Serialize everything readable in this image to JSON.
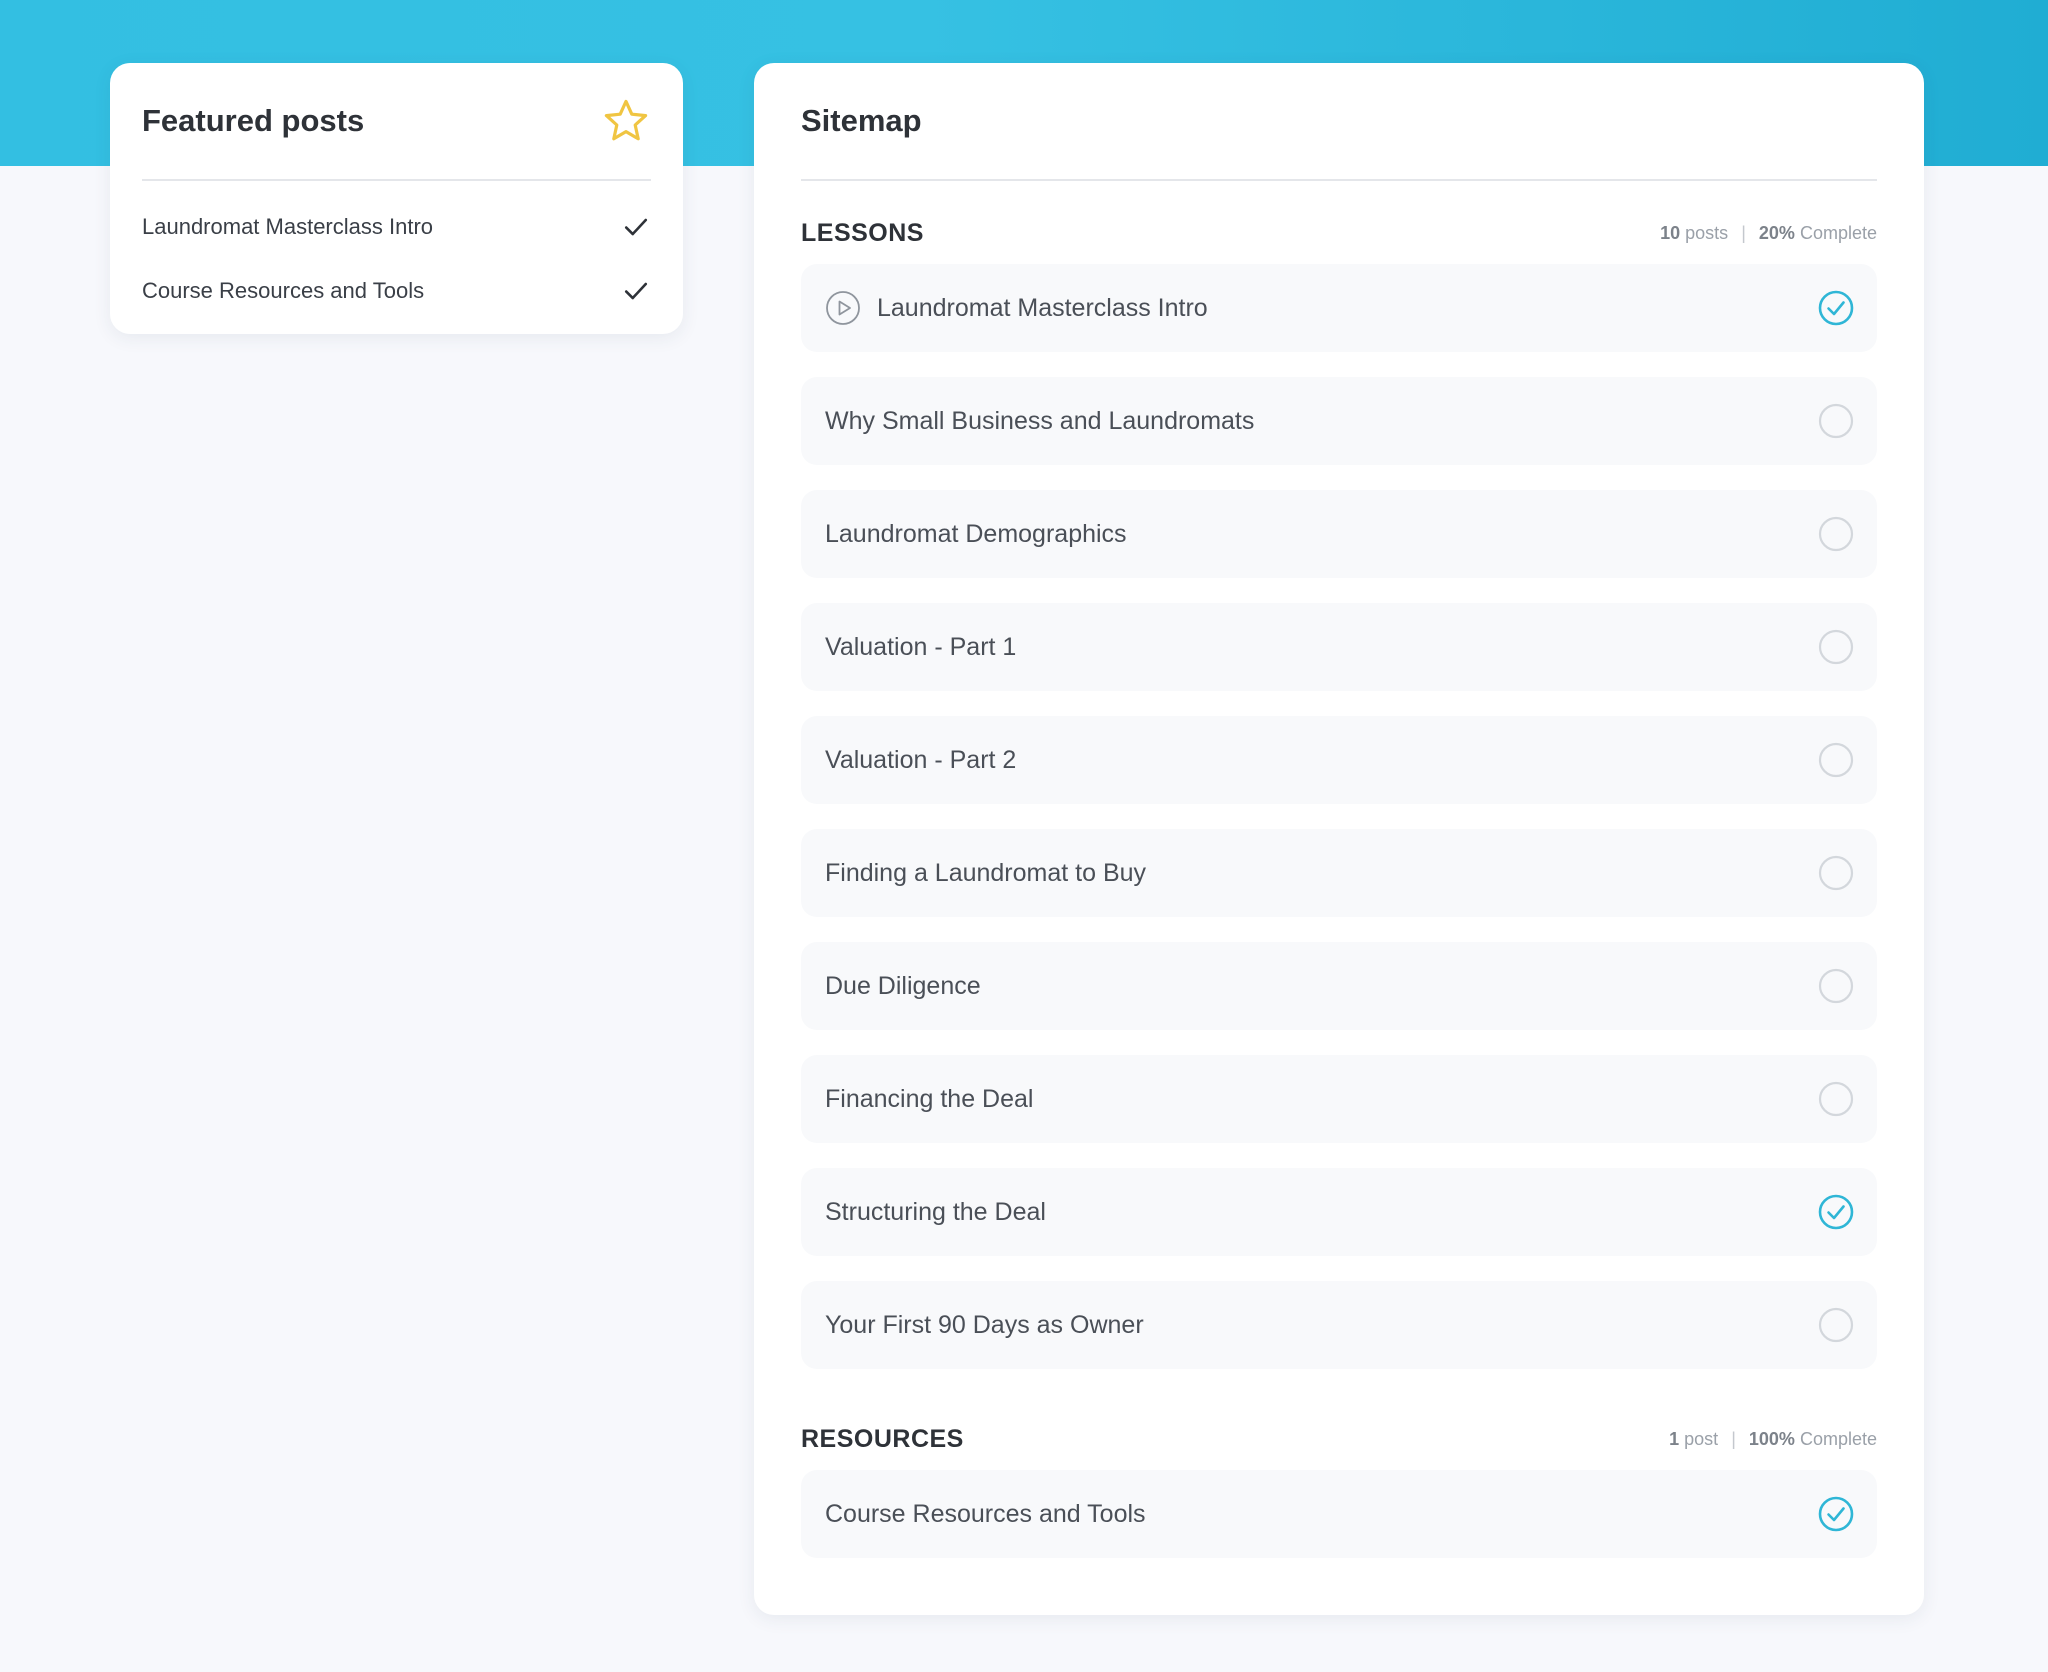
{
  "featured": {
    "title": "Featured posts",
    "items": [
      {
        "label": "Laundromat Masterclass Intro",
        "completed": true
      },
      {
        "label": "Course Resources and Tools",
        "completed": true
      }
    ]
  },
  "sitemap": {
    "title": "Sitemap",
    "sections": [
      {
        "title": "LESSONS",
        "post_count": "10",
        "post_word": "posts",
        "percent": "20%",
        "complete_word": "Complete",
        "items": [
          {
            "label": "Laundromat Masterclass Intro",
            "completed": true,
            "current": true
          },
          {
            "label": "Why Small Business and Laundromats",
            "completed": false
          },
          {
            "label": "Laundromat Demographics",
            "completed": false
          },
          {
            "label": "Valuation - Part 1",
            "completed": false
          },
          {
            "label": "Valuation - Part 2",
            "completed": false
          },
          {
            "label": "Finding a Laundromat to Buy",
            "completed": false
          },
          {
            "label": "Due Diligence",
            "completed": false
          },
          {
            "label": "Financing the Deal",
            "completed": false
          },
          {
            "label": "Structuring the Deal",
            "completed": true
          },
          {
            "label": "Your First 90 Days as Owner",
            "completed": false
          }
        ]
      },
      {
        "title": "RESOURCES",
        "post_count": "1",
        "post_word": "post",
        "percent": "100%",
        "complete_word": "Complete",
        "items": [
          {
            "label": "Course Resources and Tools",
            "completed": true
          }
        ]
      }
    ]
  },
  "colors": {
    "accent": "#2fb6d6",
    "star": "#f0c542",
    "banner": "#33bfe2"
  },
  "icons": {
    "featured_star": "star-outline-icon",
    "featured_check": "check-icon",
    "current_lesson": "play-circle-icon",
    "completed": "check-circle-icon",
    "incomplete": "empty-circle-icon"
  }
}
